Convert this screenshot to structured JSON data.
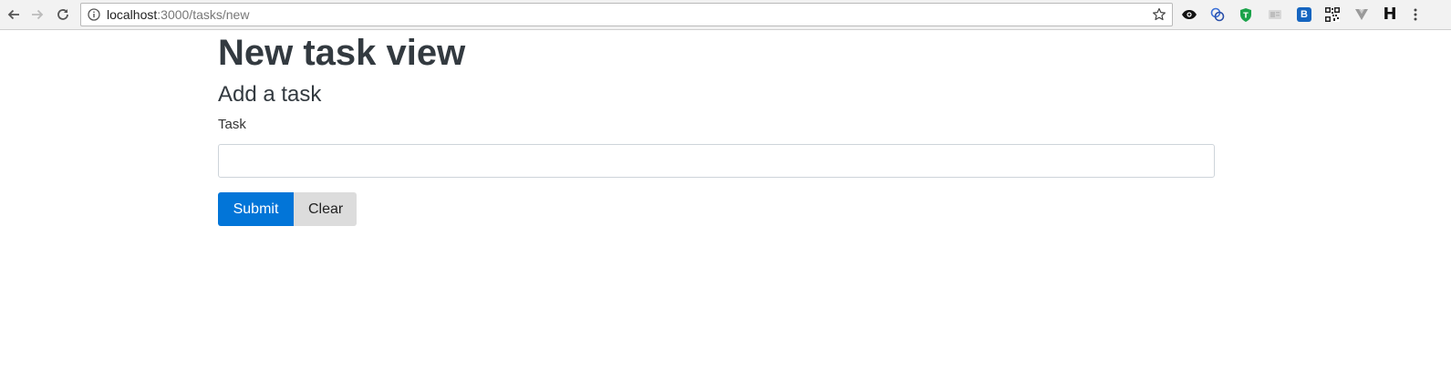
{
  "browser": {
    "url_host": "localhost",
    "url_path": ":3000/tasks/new",
    "extensions": [
      {
        "icon": "eye-icon"
      },
      {
        "icon": "grammar-extension-icon"
      },
      {
        "icon": "shield-extension-icon",
        "color": "#1aa34a"
      },
      {
        "icon": "page-extension-icon"
      },
      {
        "icon": "b-extension-icon",
        "label": "B",
        "color": "#1565c0"
      },
      {
        "icon": "qr-code-icon"
      },
      {
        "icon": "vue-devtools-icon"
      },
      {
        "icon": "h-extension-icon",
        "label": "H"
      }
    ]
  },
  "page": {
    "title": "New task view",
    "subtitle": "Add a task",
    "form": {
      "task_label": "Task",
      "task_value": "",
      "submit_label": "Submit",
      "clear_label": "Clear"
    }
  },
  "colors": {
    "primary": "#0275d8",
    "secondary": "#dcdcdc",
    "heading": "#333a40"
  }
}
